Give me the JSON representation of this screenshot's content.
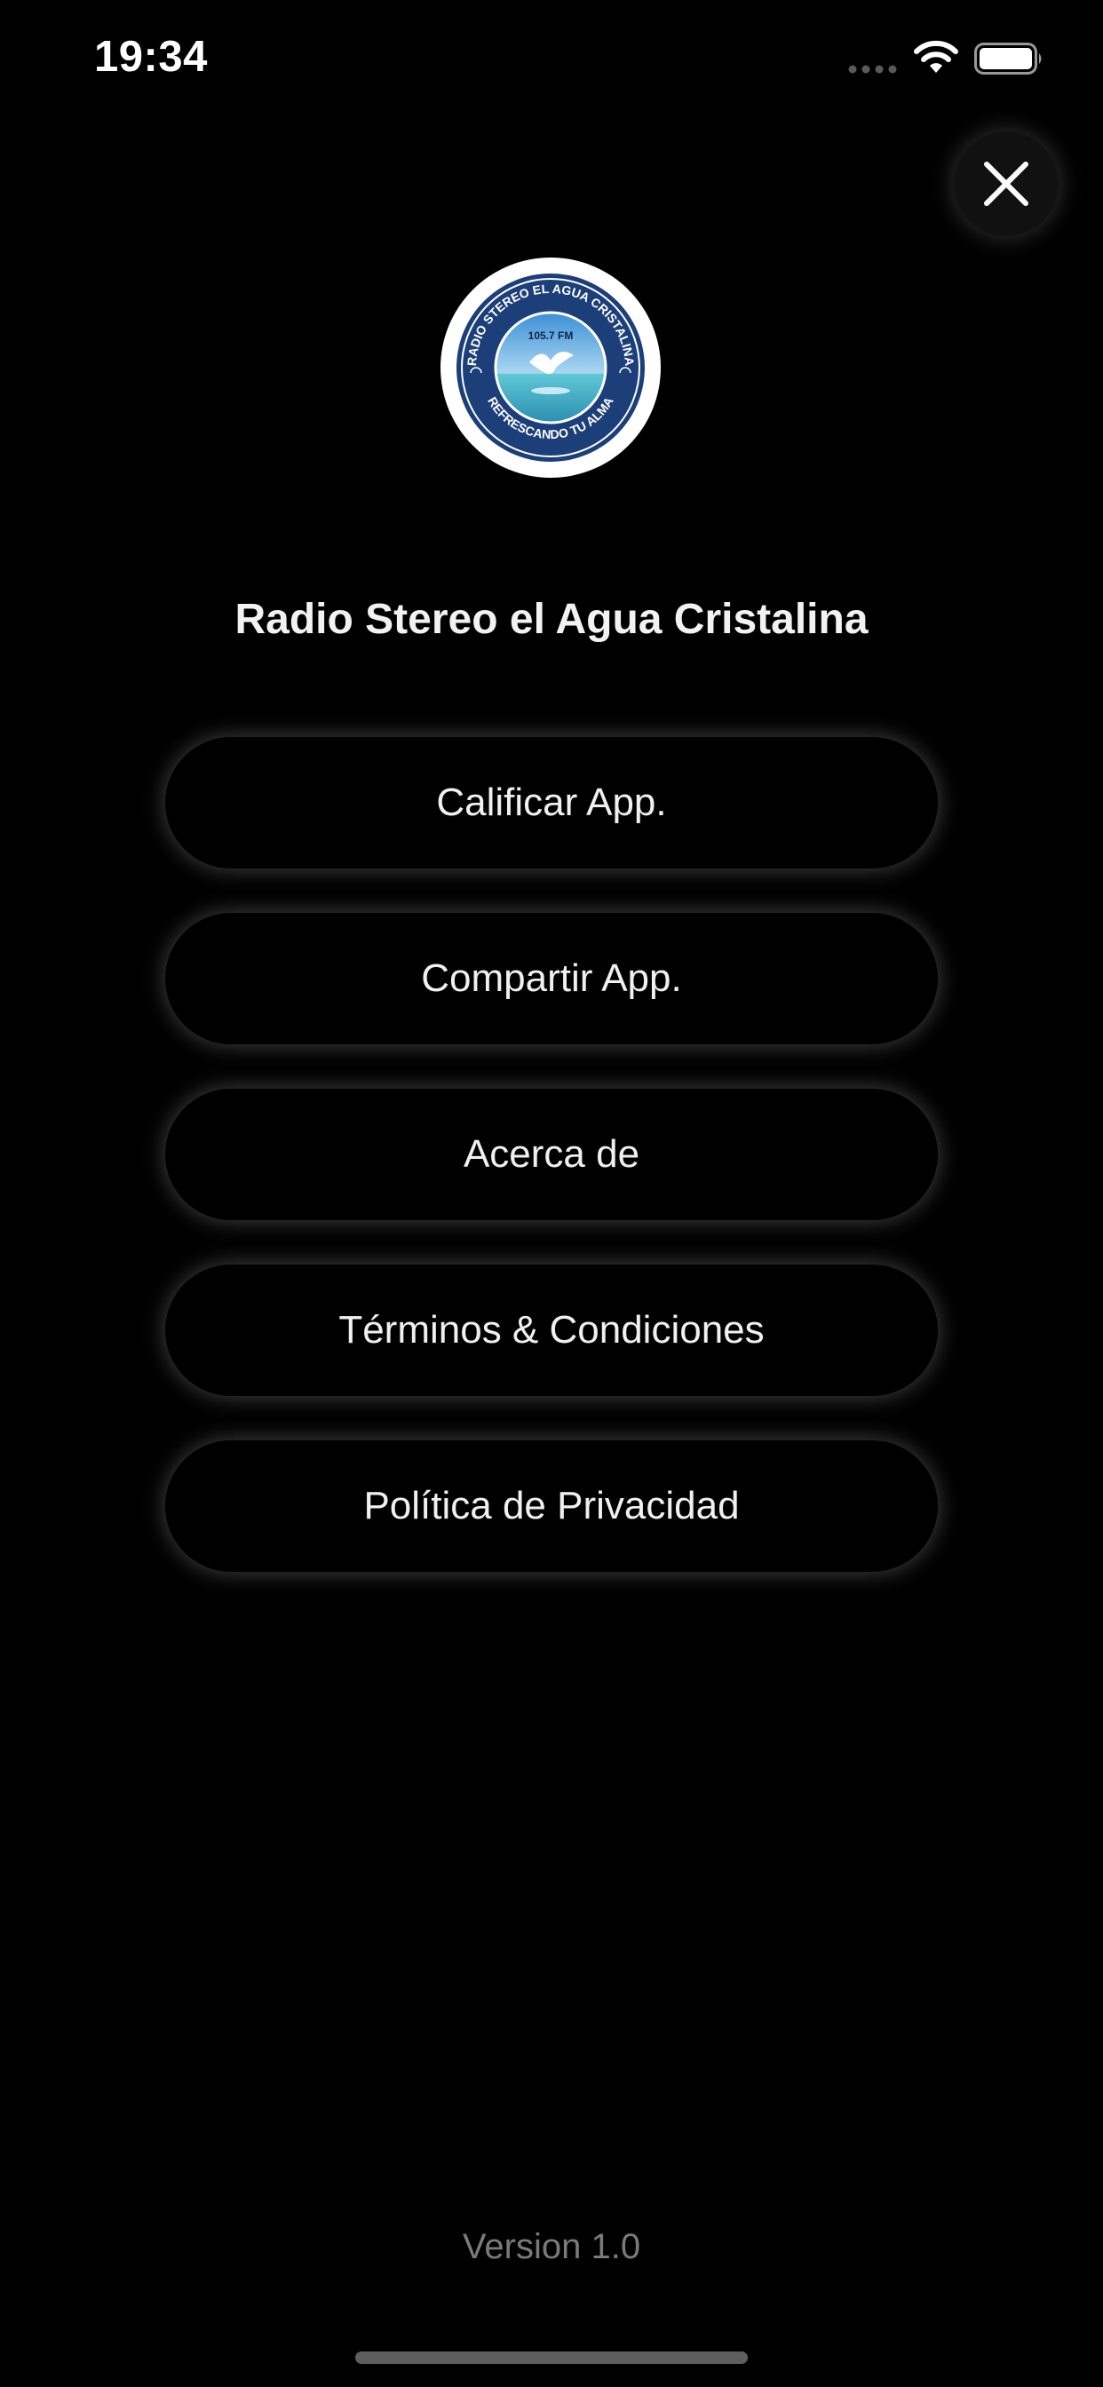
{
  "status_bar": {
    "time": "19:34",
    "signal_icon": "cellular-signal-icon",
    "wifi_icon": "wifi-icon",
    "battery_icon": "battery-icon"
  },
  "header": {
    "close_icon": "close-icon"
  },
  "logo": {
    "ring_top_text": "RADIO STEREO EL AGUA CRISTALINA",
    "frequency": "105.7 FM",
    "ring_bottom_text": "REFRESCANDO TU ALMA"
  },
  "app_title": "Radio Stereo el Agua Cristalina",
  "menu": {
    "items": [
      {
        "label": "Calificar App."
      },
      {
        "label": "Compartir App."
      },
      {
        "label": "Acerca de"
      },
      {
        "label": "Términos & Condiciones"
      },
      {
        "label": "Política de Privacidad"
      }
    ]
  },
  "footer": {
    "version": "Version 1.0"
  },
  "colors": {
    "background": "#000000",
    "text": "#f0f0f0",
    "muted_text": "#7a7a7a",
    "logo_navy": "#1c3f7a"
  }
}
